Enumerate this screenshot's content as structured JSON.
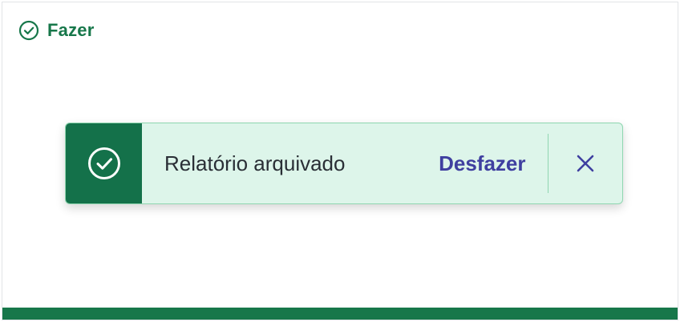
{
  "header": {
    "icon": "check-circle-icon",
    "title": "Fazer"
  },
  "toast": {
    "status_icon": "check-circle-icon",
    "message": "Relatório arquivado",
    "undo_label": "Desfazer",
    "close_icon": "close-icon"
  },
  "colors": {
    "brand_green": "#17774a",
    "toast_background": "#ddf5ea",
    "toast_border": "#8fd6b0",
    "undo_link": "#3f3fa0"
  }
}
